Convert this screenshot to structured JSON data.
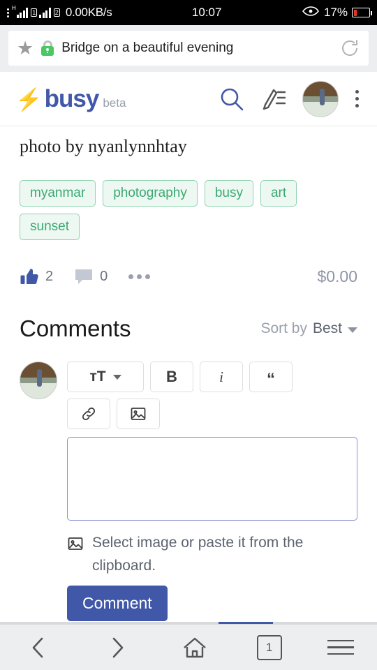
{
  "status_bar": {
    "network_type": "H",
    "sim1_label": "1",
    "sim2_label": "2",
    "data_speed": "0.00KB/s",
    "time": "10:07",
    "battery_percent": "17%",
    "eye_icon": "eye-care-icon"
  },
  "browser": {
    "star_icon": "bookmark-star-icon",
    "lock_icon": "unlocked-padlock-icon",
    "page_title": "Bridge on a beautiful evening",
    "reload_icon": "reload-icon"
  },
  "app_header": {
    "logo_bolt": "⚡",
    "logo_text": "busy",
    "beta_label": "beta",
    "search_icon": "search-icon",
    "write_icon": "write-post-icon",
    "avatar": "user-avatar",
    "menu_icon": "kebab-menu-icon"
  },
  "post": {
    "body_text": "photo by nyanlynnhtay",
    "tags": [
      "myanmar",
      "photography",
      "busy",
      "art",
      "sunset"
    ],
    "like_count": "2",
    "comment_count": "0",
    "more_icon": "more-options-icon",
    "payout": "$0.00"
  },
  "comments_section": {
    "title": "Comments",
    "sort_label": "Sort by",
    "sort_value": "Best"
  },
  "editor": {
    "text_size_label": "тT",
    "bold_label": "B",
    "italic_label": "i",
    "quote_label": "“",
    "link_icon": "link-icon",
    "image_icon": "image-icon",
    "textarea_value": "",
    "textarea_placeholder": "",
    "image_hint": "Select image or paste it from the clipboard.",
    "submit_label": "Comment"
  },
  "bottom_nav": {
    "back_icon": "chevron-left-icon",
    "forward_icon": "chevron-right-icon",
    "home_icon": "home-icon",
    "tab_count": "1",
    "menu_icon": "hamburger-menu-icon"
  },
  "colors": {
    "brand": "#4157a7",
    "tag_text": "#3aa971",
    "tag_bg": "#eef8f2",
    "battery_low": "#e8342a",
    "lock_green": "#4cc764"
  }
}
